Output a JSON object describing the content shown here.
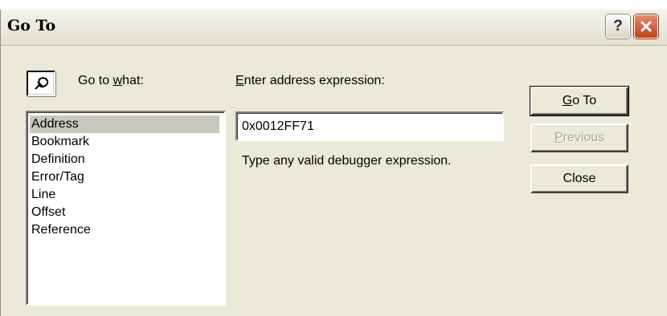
{
  "window": {
    "title": "Go To"
  },
  "titlebar": {
    "help_glyph": "?",
    "help_icon": "question-mark-icon",
    "close_icon": "close-x-icon"
  },
  "go_to_what": {
    "label_prefix": "Go to ",
    "label_mnemonic": "w",
    "label_suffix": "hat:",
    "toggle_icon": "pin-icon",
    "items": [
      "Address",
      "Bookmark",
      "Definition",
      "Error/Tag",
      "Line",
      "Offset",
      "Reference"
    ],
    "selected": "Address"
  },
  "address": {
    "label_mnemonic": "E",
    "label_rest": "nter address expression:",
    "value": "0x0012FF71",
    "hint": "Type any valid debugger expression."
  },
  "buttons": {
    "goto": {
      "mnemonic": "G",
      "rest": "o To"
    },
    "previous": {
      "mnemonic": "P",
      "rest": "revious"
    },
    "close": {
      "label": "Close"
    }
  },
  "colors": {
    "dialog_bg": "#ece9d8",
    "selection_bg": "#c9c6bd",
    "close_btn": "#c3411a"
  }
}
